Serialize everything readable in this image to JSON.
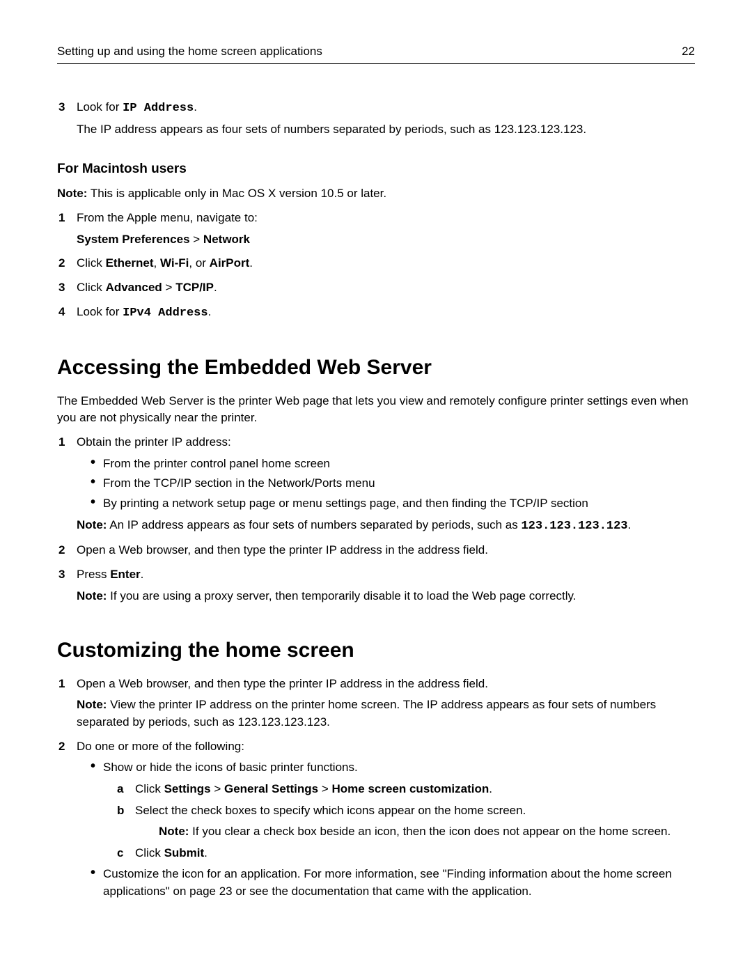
{
  "header": {
    "title": "Setting up and using the home screen applications",
    "page": "22"
  },
  "step3": {
    "num": "3",
    "prefix": "Look for ",
    "code": "IP Address",
    "suffix": ".",
    "desc": "The IP address appears as four sets of numbers separated by periods, such as 123.123.123.123."
  },
  "mac": {
    "heading": "For Macintosh users",
    "note_label": "Note:",
    "note_text": " This is applicable only in Mac OS X version 10.5 or later.",
    "s1": {
      "num": "1",
      "text": "From the Apple menu, navigate to:",
      "path_1": "System Preferences",
      "gt": " > ",
      "path_2": "Network"
    },
    "s2": {
      "num": "2",
      "pre": "Click ",
      "b1": "Ethernet",
      "sep1": ", ",
      "b2": "Wi-Fi",
      "sep2": ", or ",
      "b3": "AirPort",
      "post": "."
    },
    "s3": {
      "num": "3",
      "pre": "Click ",
      "b1": "Advanced",
      "gt": " > ",
      "b2": "TCP/IP",
      "post": "."
    },
    "s4": {
      "num": "4",
      "pre": "Look for ",
      "code": "IPv4 Address",
      "post": "."
    }
  },
  "ews": {
    "heading": "Accessing the Embedded Web Server",
    "intro": "The Embedded Web Server is the printer Web page that lets you view and remotely configure printer settings even when you are not physically near the printer.",
    "s1": {
      "num": "1",
      "text": "Obtain the printer IP address:",
      "b1": "From the printer control panel home screen",
      "b2": "From the TCP/IP section in the Network/Ports menu",
      "b3": "By printing a network setup page or menu settings page, and then finding the TCP/IP section",
      "note_label": "Note:",
      "note_text": " An IP address appears as four sets of numbers separated by periods, such as ",
      "note_code": "123.123.123.123",
      "note_post": "."
    },
    "s2": {
      "num": "2",
      "text": "Open a Web browser, and then type the printer IP address in the address field."
    },
    "s3": {
      "num": "3",
      "pre": "Press ",
      "b1": "Enter",
      "post": ".",
      "note_label": "Note:",
      "note_text": " If you are using a proxy server, then temporarily disable it to load the Web page correctly."
    }
  },
  "custom": {
    "heading": "Customizing the home screen",
    "s1": {
      "num": "1",
      "text": "Open a Web browser, and then type the printer IP address in the address field.",
      "note_label": "Note:",
      "note_text": " View the printer IP address on the printer home screen. The IP address appears as four sets of numbers separated by periods, such as 123.123.123.123."
    },
    "s2": {
      "num": "2",
      "text": "Do one or more of the following:",
      "b1": "Show or hide the icons of basic printer functions.",
      "a": {
        "num": "a",
        "pre": "Click ",
        "p1": "Settings",
        "gt1": " > ",
        "p2": "General Settings",
        "gt2": " > ",
        "p3": "Home screen customization",
        "post": "."
      },
      "b": {
        "num": "b",
        "text": "Select the check boxes to specify which icons appear on the home screen.",
        "note_label": "Note:",
        "note_text": " If you clear a check box beside an icon, then the icon does not appear on the home screen."
      },
      "c": {
        "num": "c",
        "pre": "Click ",
        "b1": "Submit",
        "post": "."
      },
      "b2": "Customize the icon for an application. For more information, see \"Finding information about the home screen applications\" on page 23 or see the documentation that came with the application."
    }
  }
}
